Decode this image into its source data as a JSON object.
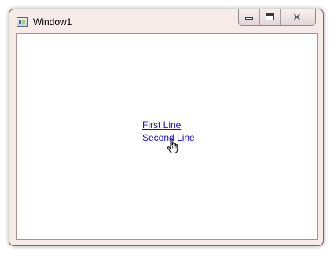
{
  "window": {
    "title": "Window1",
    "controls": {
      "minimize": "minimize",
      "maximize": "maximize",
      "close": "×"
    }
  },
  "content": {
    "links": [
      {
        "label": "First Line"
      },
      {
        "label": "Second Line"
      }
    ]
  },
  "icons": {
    "app": "app-window-icon",
    "cursor": "hand-pointer-icon"
  },
  "colors": {
    "link": "#1a0dcc",
    "title_bar": "#f7ebe9",
    "client_background": "#ffffff"
  }
}
